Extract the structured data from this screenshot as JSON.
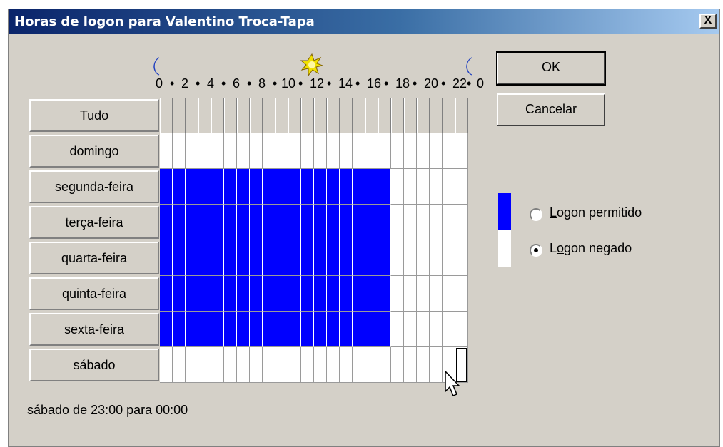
{
  "dialog": {
    "title": "Horas de logon para Valentino Troca-Tapa",
    "close_label": "X"
  },
  "buttons": {
    "ok_label": "OK",
    "cancel_label": "Cancelar"
  },
  "icons": {
    "left_moon": "moon-icon",
    "center_sun": "sun-icon",
    "right_moon": "moon-icon"
  },
  "timeline_labels": [
    "0",
    "•",
    "2",
    "•",
    "4",
    "•",
    "6",
    "•",
    "8",
    "•",
    "10",
    "•",
    "12",
    "•",
    "14",
    "•",
    "16",
    "•",
    "18",
    "•",
    "20",
    "•",
    "22",
    "•",
    "0"
  ],
  "rows": [
    {
      "label": "Tudo"
    },
    {
      "label": "domingo",
      "allowed": []
    },
    {
      "label": "segunda-feira",
      "allowed": [
        0,
        18
      ]
    },
    {
      "label": "terça-feira",
      "allowed": [
        0,
        18
      ]
    },
    {
      "label": "quarta-feira",
      "allowed": [
        0,
        18
      ]
    },
    {
      "label": "quinta-feira",
      "allowed": [
        0,
        18
      ]
    },
    {
      "label": "sexta-feira",
      "allowed": [
        0,
        18
      ]
    },
    {
      "label": "sábado",
      "allowed": []
    }
  ],
  "selection": {
    "day_index": 7,
    "hour": 23
  },
  "legend": {
    "colors": {
      "allowed": "#0000ff",
      "denied": "#ffffff"
    },
    "allowed_label": "Logon permitido",
    "allowed_mnemonic": "L",
    "allowed_rest": "ogon permitido",
    "denied_label": "Logon negado",
    "denied_prefix": "L",
    "denied_mnemonic": "o",
    "denied_rest": "gon negado",
    "selected": "denied"
  },
  "status_text": "sábado de 23:00 para 00:00"
}
